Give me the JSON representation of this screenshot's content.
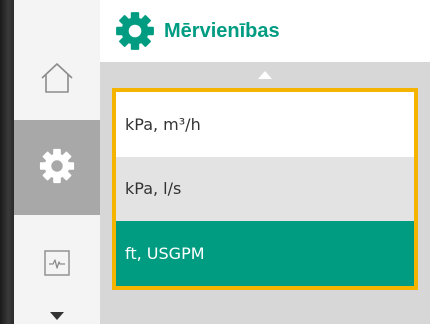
{
  "header": {
    "title": "Mērvienības",
    "icon": "gear-icon",
    "accent_color": "#009c82"
  },
  "rail": {
    "items": [
      {
        "icon": "home-icon"
      },
      {
        "icon": "gear-icon",
        "active": true
      },
      {
        "icon": "diagnostics-icon"
      }
    ],
    "bottom_indicator": "chevron-down-icon"
  },
  "list": {
    "scroll_indicator": "chevron-up-icon",
    "highlight_color": "#f5b400",
    "options": [
      {
        "label": "kPa, m³/h"
      },
      {
        "label": "kPa, l/s"
      },
      {
        "label": "ft, USGPM",
        "selected": true
      }
    ]
  }
}
